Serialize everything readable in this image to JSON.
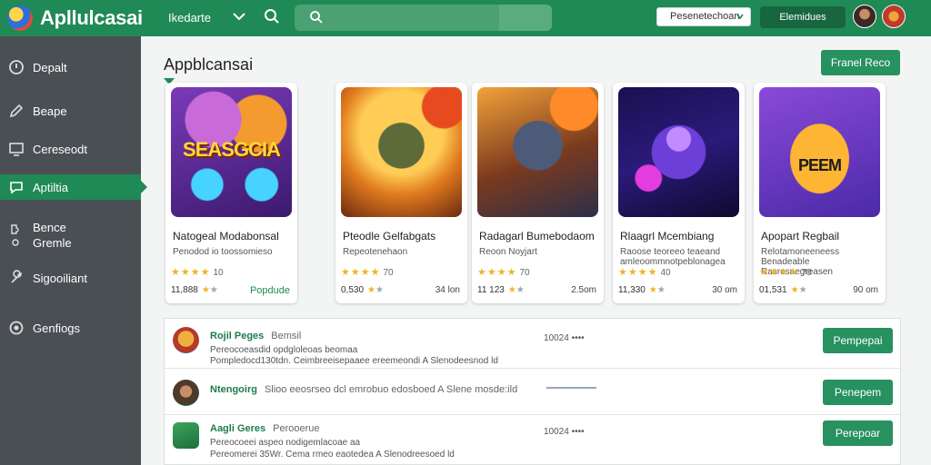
{
  "app": {
    "brand": "Apllulcasai"
  },
  "topbar": {
    "nav_label": "Ikedarte",
    "search_placeholder": "",
    "select_value": "Pesenetechoan",
    "button_label": "Elemidues"
  },
  "sidebar": {
    "items": [
      {
        "label": "Depalt",
        "icon": "dashboard-icon"
      },
      {
        "label": "Beape",
        "icon": "pencil-icon"
      },
      {
        "label": "Cereseodt",
        "icon": "monitor-icon"
      },
      {
        "label": "Aptiltia",
        "icon": "chat-icon",
        "active": true
      },
      {
        "label": "Bence\nGremle",
        "icon": "puzzle-icon"
      },
      {
        "label": "Sigooiliant",
        "icon": "wrench-icon"
      },
      {
        "label": "Genfiogs",
        "icon": "settings-icon"
      }
    ]
  },
  "main": {
    "title": "Appblcansai",
    "header_button": "Franel Reco"
  },
  "cards": [
    {
      "art_text": "SEASGCIA",
      "name": "Natogeal Modabonsal",
      "desc": "Penodod io toossomieso",
      "rating": "10",
      "count": "11,888",
      "size": "Popdude",
      "size_green": true
    },
    {
      "art_text": "",
      "name": "Pteodle Gelfabgats",
      "desc": "Repeotenehaon",
      "rating": "70",
      "count": "0,530",
      "size": "34 lon",
      "size_green": false
    },
    {
      "art_text": "",
      "name": "Radagarl Bumebodaom",
      "desc": "Reoon Noyjart",
      "rating": "70",
      "count": "11 123",
      "size": "2.5om",
      "size_green": false
    },
    {
      "art_text": "",
      "name": "Rlaagrl Mcembiang",
      "desc": "Raoose teoreeo teaeand amleoommnotpeblonagea",
      "rating": "40",
      "count": "11,330",
      "size": "30 om",
      "size_green": false
    },
    {
      "art_text": "PEEM",
      "name": "Apopart Regbail",
      "desc": "Relotamoneeneess Benadeable Rasrosnegreasen",
      "rating": "70",
      "count": "01,531",
      "size": "90 om",
      "size_green": false
    }
  ],
  "list": [
    {
      "title": "Rojil Peges",
      "tag": "Bemsil",
      "line1": "Pereocoeasdid opdgloleoas beomaa",
      "line2": "Pompledocd130tdn. Ceimbreeisepaaee ereemeondi A Slenodeesnod ld",
      "time": "10024 ••••",
      "button": "Pempepai"
    },
    {
      "title": "Ntengoirg",
      "tag": "Slioo eeosrseo dcl emrobuo edosboed A Slene mosde:ild",
      "line1": "",
      "line2": "",
      "time": "",
      "button": "Penepem"
    },
    {
      "title": "Aagli Geres",
      "tag": "Perooerue",
      "line1": "Pereocoeei aspeo nodigemlacoae aa",
      "line2": "Pereomerei 35Wr. Cema rmeo eaotedea A Slenodreesoed ld",
      "time": "10024 ••••",
      "button": "Perepoar"
    }
  ],
  "colors": {
    "accent": "#1f8a55",
    "sidebar": "#4a4f54",
    "stars": "#f0b323"
  }
}
